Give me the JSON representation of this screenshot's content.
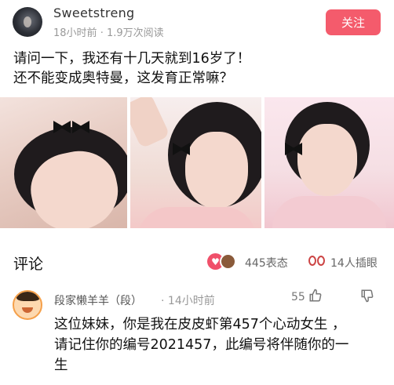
{
  "post": {
    "author": "Sweetstreng",
    "time": "18小时前",
    "views": "1.9万次阅读",
    "follow_label": "关注",
    "text_line1": "请问一下，我还有十几天就到16岁了！",
    "text_line2": "还不能变成奥特曼，这发育正常嘛？",
    "photos": [
      "photo-1",
      "photo-2",
      "photo-3"
    ]
  },
  "comments_section": {
    "title": "评论",
    "reactions_count": "445表态",
    "insert_count": "14人插眼"
  },
  "comment": {
    "author": "段家懒羊羊（段）",
    "time": "14小时前",
    "likes": "55",
    "text_line1": "这位妹妹，你是我在皮皮虾第457个心动女生 ，",
    "text_line2": "请记住你的编号2021457，此编号将伴随你的一",
    "text_line3": "生"
  },
  "colors": {
    "follow_button": "#f45b6c",
    "heart_reaction": "#f0506a"
  }
}
